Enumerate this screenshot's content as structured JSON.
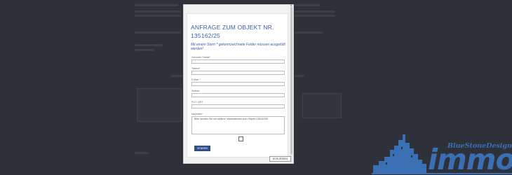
{
  "modal": {
    "close_glyph": "×",
    "title": "ANFRAGE ZUM OBJEKT NR. 135162/25",
    "subtitle": "Mit einem Stern * gekennzeichnete Felder müssen ausgefüllt werden!",
    "fields": {
      "name": {
        "label": "Vorname / Name*",
        "value": ""
      },
      "phone": {
        "label": "Telefon*",
        "value": ""
      },
      "email": {
        "label": "E-Mail: *",
        "value": ""
      },
      "street": {
        "label": "Strasse",
        "value": ""
      },
      "city": {
        "label": "PLZ / ORT",
        "value": ""
      },
      "message": {
        "label": "Nachricht*",
        "value": "Bitte senden Sie mir weitere Informationen zum Objekt 135162/25"
      }
    },
    "send_label": "SENDEN",
    "close_label": "SCHLIESSEN"
  },
  "logo": {
    "brand": "BlueStoneDesign",
    "word": "immo",
    "brand_color": "#3b6fb4"
  },
  "colors": {
    "overlay": "#2d3038",
    "accent": "#2f4f86",
    "title": "#3b5fa0"
  }
}
